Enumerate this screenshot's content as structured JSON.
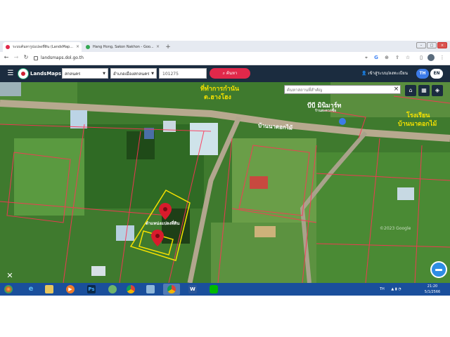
{
  "browser": {
    "tabs": [
      {
        "label": "ระบบค้นหารูปแปลงที่ดิน (LandsMap...",
        "close": "×",
        "favicon_color": "#e0284a"
      },
      {
        "label": "Hang Hong, Sakon Nakhon - Goo...",
        "close": "×",
        "favicon_color": "#34a853"
      }
    ],
    "new_tab": "+",
    "window": {
      "minimize": "–",
      "maximize": "□",
      "close": "×"
    },
    "url": "landsmaps.dol.go.th",
    "nav": {
      "back": "←",
      "forward": "→",
      "reload": "↻"
    }
  },
  "app": {
    "brand": "LandsMaps",
    "province": "สกลนคร",
    "district": "อำเภอเมืองสกลนคร",
    "parcel_number": "101275",
    "search_label": "ค้นหา",
    "login_label": "เข้าสู่ระบบ/ลงทะเบียน",
    "lang_th": "TH",
    "lang_en": "EN"
  },
  "map": {
    "search_placeholder": "ค้นหาสถานที่สำคัญ",
    "close": "×",
    "labels": {
      "top_center_line1": "ที่ทำการกำนัน",
      "top_center_line2": "ต.ฮางโฮง",
      "shop": "บีบี มินิมาร์ท",
      "shop_sub": "ร้านสะดวกซื้อ",
      "road": "บ้านนาดอกไม้",
      "school_line1": "โรงเรียน",
      "school_line2": "บ้านนาดอกไม้",
      "parcel_caption": "ตำแหน่งแปลงที่ดิน",
      "watermark": "©2023 Google"
    },
    "accent_yellow": "#f5e100",
    "pin_color": "#d81b2c"
  },
  "taskbar": {
    "apps": [
      "explorer",
      "ie",
      "files",
      "media",
      "photoshop",
      "maps",
      "chrome",
      "control",
      "chrome2",
      "word",
      "line"
    ],
    "ps_label": "Ps",
    "word_label": "W",
    "lang": "TH",
    "time": "21:20",
    "date": "5/1/2566"
  }
}
